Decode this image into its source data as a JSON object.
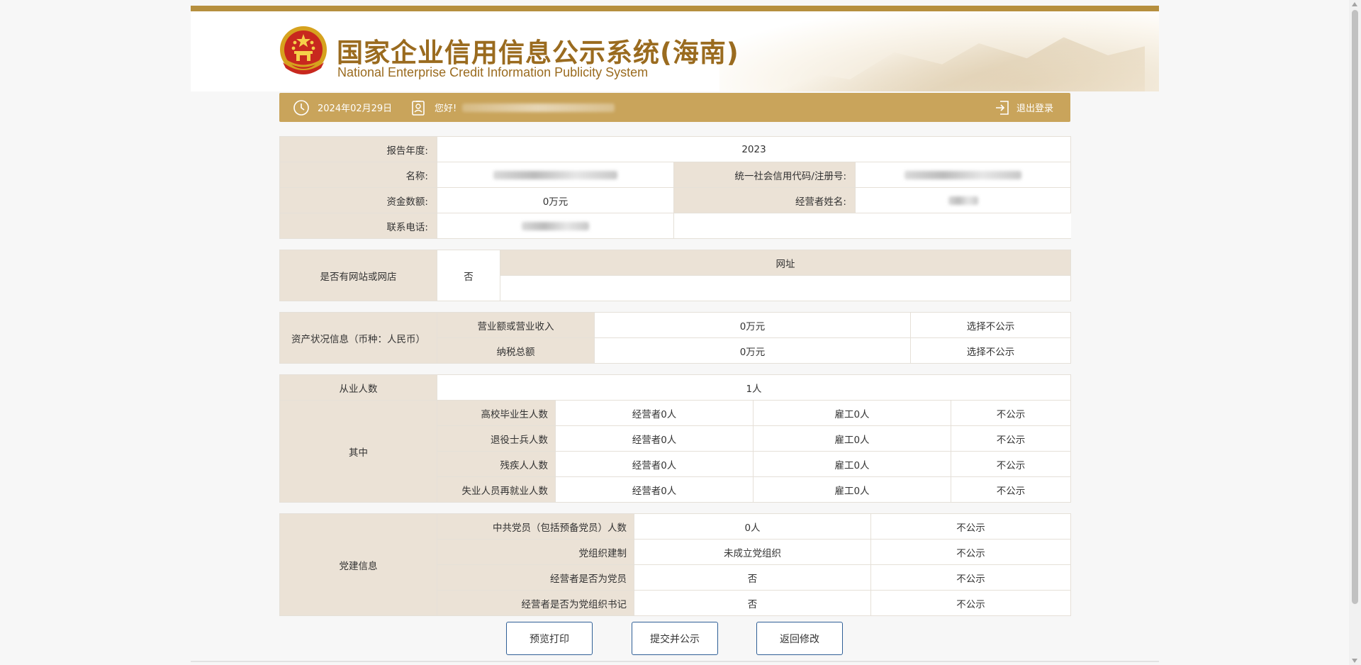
{
  "header": {
    "title_cn": "国家企业信用信息公示系统(海南)",
    "title_en": "National Enterprise Credit Information Publicity System"
  },
  "userbar": {
    "date": "2024年02月29日",
    "greeting": "您好!",
    "logout": "退出登录"
  },
  "basic": {
    "year_label": "报告年度:",
    "year_value": "2023",
    "name_label": "名称:",
    "name_value": "",
    "credit_code_label": "统一社会信用代码/注册号:",
    "credit_code_value": "",
    "capital_label": "资金数额:",
    "capital_value": "0万元",
    "operator_label": "经营者姓名:",
    "operator_value": "",
    "phone_label": "联系电话:",
    "phone_value": ""
  },
  "website": {
    "label": "是否有网站或网店",
    "value": "否",
    "url_header": "网址",
    "url_value": ""
  },
  "assets": {
    "label": "资产状况信息（币种：人民币）",
    "rows": [
      {
        "item": "营业额或营业收入",
        "value": "0万元",
        "public": "选择不公示"
      },
      {
        "item": "纳税总额",
        "value": "0万元",
        "public": "选择不公示"
      }
    ]
  },
  "employees": {
    "label": "从业人数",
    "value": "1人",
    "among_label": "其中",
    "rows": [
      {
        "item": "高校毕业生人数",
        "operator": "经营者0人",
        "employee": "雇工0人",
        "public": "不公示"
      },
      {
        "item": "退役士兵人数",
        "operator": "经营者0人",
        "employee": "雇工0人",
        "public": "不公示"
      },
      {
        "item": "残疾人人数",
        "operator": "经营者0人",
        "employee": "雇工0人",
        "public": "不公示"
      },
      {
        "item": "失业人员再就业人数",
        "operator": "经营者0人",
        "employee": "雇工0人",
        "public": "不公示"
      }
    ]
  },
  "party": {
    "label": "党建信息",
    "rows": [
      {
        "item": "中共党员（包括预备党员）人数",
        "value": "0人",
        "public": "不公示"
      },
      {
        "item": "党组织建制",
        "value": "未成立党组织",
        "public": "不公示"
      },
      {
        "item": "经营者是否为党员",
        "value": "否",
        "public": "不公示"
      },
      {
        "item": "经营者是否为党组织书记",
        "value": "否",
        "public": "不公示"
      }
    ]
  },
  "buttons": {
    "preview": "预览打印",
    "submit": "提交并公示",
    "back": "返回修改"
  }
}
